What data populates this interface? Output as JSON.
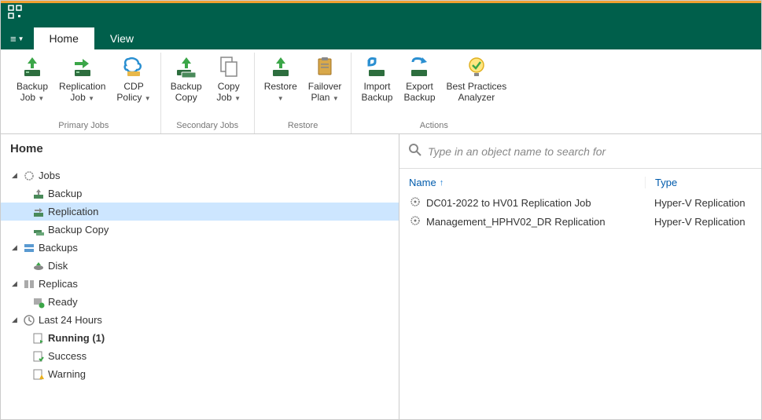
{
  "window": {
    "menu_glyph": "≡"
  },
  "tabs": {
    "home": "Home",
    "view": "View"
  },
  "ribbon": {
    "groups": {
      "primary": {
        "label": "Primary Jobs",
        "backup_job": "Backup\nJob",
        "replication_job": "Replication\nJob",
        "cdp_policy": "CDP\nPolicy"
      },
      "secondary": {
        "label": "Secondary Jobs",
        "backup_copy": "Backup\nCopy",
        "copy_job": "Copy\nJob"
      },
      "restore": {
        "label": "Restore",
        "restore": "Restore",
        "failover_plan": "Failover\nPlan"
      },
      "actions": {
        "label": "Actions",
        "import_backup": "Import\nBackup",
        "export_backup": "Export\nBackup",
        "best_practices": "Best Practices\nAnalyzer"
      }
    }
  },
  "nav": {
    "header": "Home",
    "tree": {
      "jobs": "Jobs",
      "backup": "Backup",
      "replication": "Replication",
      "backup_copy": "Backup Copy",
      "backups": "Backups",
      "disk": "Disk",
      "replicas": "Replicas",
      "ready": "Ready",
      "last24": "Last 24 Hours",
      "running": "Running (1)",
      "success": "Success",
      "warning": "Warning"
    }
  },
  "search": {
    "placeholder": "Type in an object name to search for"
  },
  "grid": {
    "columns": {
      "name": "Name",
      "type": "Type"
    },
    "rows": [
      {
        "name": "DC01-2022 to HV01 Replication Job",
        "type": "Hyper-V Replication"
      },
      {
        "name": "Management_HPHV02_DR Replication",
        "type": "Hyper-V Replication"
      }
    ]
  }
}
